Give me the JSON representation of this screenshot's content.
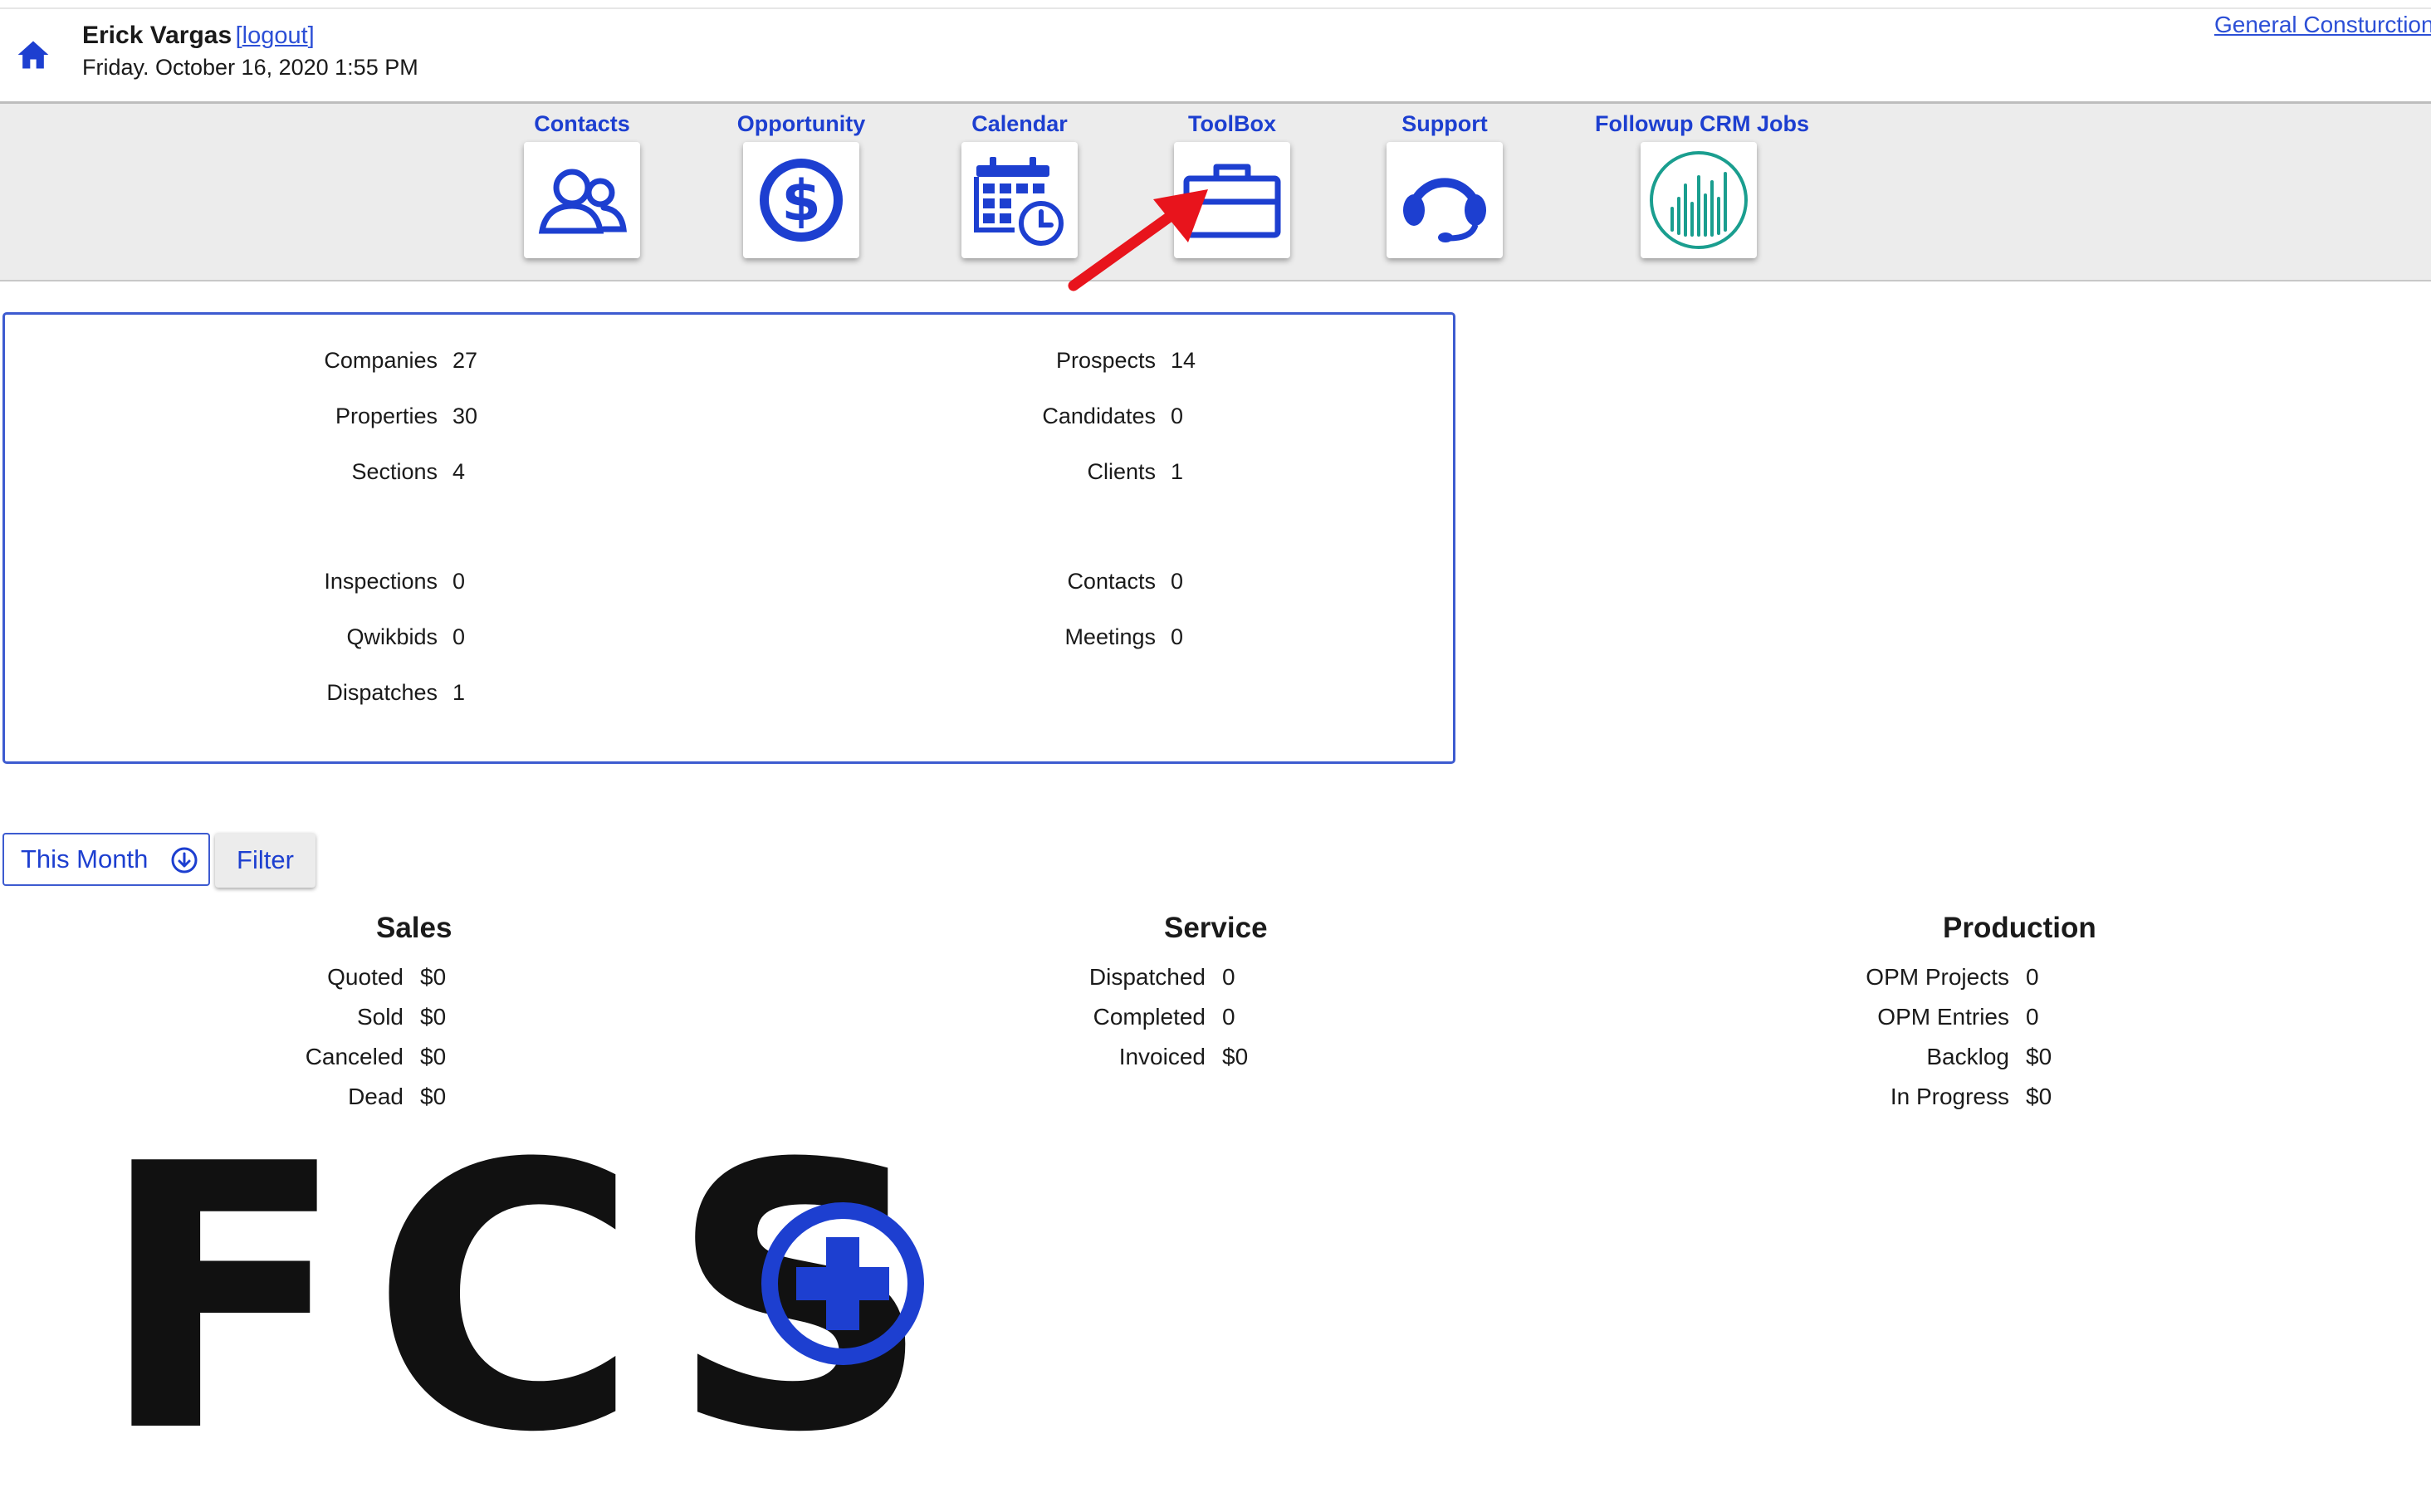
{
  "header": {
    "user_name": "Erick Vargas",
    "logout_open": "[",
    "logout_label": "logout",
    "logout_close": "]",
    "datetime": "Friday. October 16, 2020 1:55 PM",
    "company_link": "General Consturction"
  },
  "nav": [
    {
      "label": "Contacts",
      "icon": "contacts-icon"
    },
    {
      "label": "Opportunity",
      "icon": "dollar-icon"
    },
    {
      "label": "Calendar",
      "icon": "calendar-clock-icon"
    },
    {
      "label": "ToolBox",
      "icon": "toolbox-icon"
    },
    {
      "label": "Support",
      "icon": "headset-icon"
    },
    {
      "label": "Followup CRM Jobs",
      "icon": "followup-chart-icon"
    }
  ],
  "colors": {
    "accent": "#1d3fd0",
    "annotation_arrow": "#e8141c",
    "followup_teal": "#1a9e8f"
  },
  "stats": {
    "left": [
      {
        "label": "Companies",
        "value": "27"
      },
      {
        "label": "Properties",
        "value": "30"
      },
      {
        "label": "Sections",
        "value": "4"
      },
      {
        "label": "Inspections",
        "value": "0"
      },
      {
        "label": "Qwikbids",
        "value": "0"
      },
      {
        "label": "Dispatches",
        "value": "1"
      }
    ],
    "right": [
      {
        "label": "Prospects",
        "value": "14"
      },
      {
        "label": "Candidates",
        "value": "0"
      },
      {
        "label": "Clients",
        "value": "1"
      },
      {
        "label": "Contacts",
        "value": "0"
      },
      {
        "label": "Meetings",
        "value": "0"
      }
    ]
  },
  "period": {
    "selected": "This Month",
    "filter_label": "Filter"
  },
  "summary": {
    "sales": {
      "title": "Sales",
      "rows": [
        {
          "label": "Quoted",
          "value": "$0"
        },
        {
          "label": "Sold",
          "value": "$0"
        },
        {
          "label": "Canceled",
          "value": "$0"
        },
        {
          "label": "Dead",
          "value": "$0"
        }
      ]
    },
    "service": {
      "title": "Service",
      "rows": [
        {
          "label": "Dispatched",
          "value": "0"
        },
        {
          "label": "Completed",
          "value": "0"
        },
        {
          "label": "Invoiced",
          "value": "$0"
        }
      ]
    },
    "production": {
      "title": "Production",
      "rows": [
        {
          "label": "OPM Projects",
          "value": "0"
        },
        {
          "label": "OPM Entries",
          "value": "0"
        },
        {
          "label": "Backlog",
          "value": "$0"
        },
        {
          "label": "In Progress",
          "value": "$0"
        }
      ]
    }
  },
  "logo": {
    "text": "FCS"
  }
}
